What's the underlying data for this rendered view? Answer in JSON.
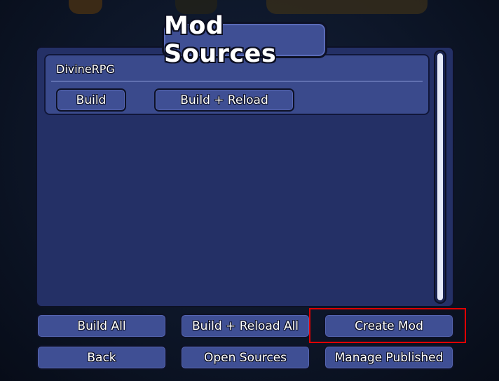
{
  "title": "Mod Sources",
  "mods": [
    {
      "name": "DivineRPG",
      "build_label": "Build",
      "build_reload_label": "Build + Reload"
    }
  ],
  "buttons": {
    "build_all": "Build All",
    "build_reload_all": "Build + Reload All",
    "create_mod": "Create Mod",
    "back": "Back",
    "open_sources": "Open Sources",
    "manage_published": "Manage Published"
  },
  "colors": {
    "panel": "#243066",
    "button": "#3f4f94",
    "highlight": "#e00000",
    "scroll_thumb": "#e6eaf8"
  }
}
